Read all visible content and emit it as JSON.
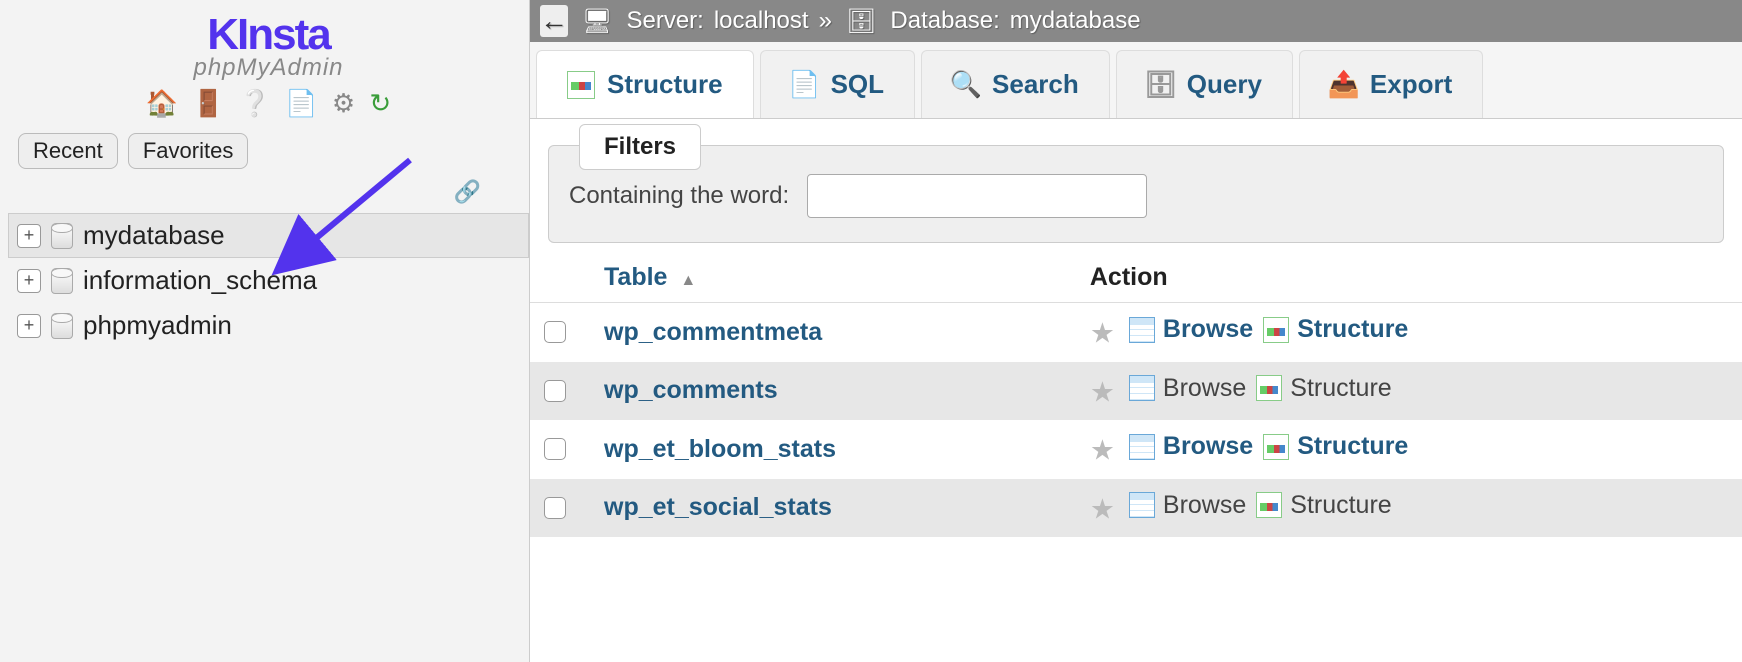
{
  "logo": {
    "brand": "KInsta",
    "sub": "phpMyAdmin"
  },
  "sidebar_tabs": {
    "recent": "Recent",
    "favorites": "Favorites"
  },
  "databases": [
    {
      "name": "mydatabase",
      "selected": true
    },
    {
      "name": "information_schema",
      "selected": false
    },
    {
      "name": "phpmyadmin",
      "selected": false
    }
  ],
  "breadcrumb": {
    "server_label": "Server:",
    "server_value": "localhost",
    "sep": "»",
    "db_label": "Database:",
    "db_value": "mydatabase"
  },
  "tabs": {
    "structure": "Structure",
    "sql": "SQL",
    "search": "Search",
    "query": "Query",
    "export": "Export"
  },
  "filters": {
    "title": "Filters",
    "label": "Containing the word:",
    "value": ""
  },
  "columns": {
    "table": "Table",
    "action": "Action"
  },
  "row_actions": {
    "browse": "Browse",
    "structure": "Structure"
  },
  "tables": [
    "wp_commentmeta",
    "wp_comments",
    "wp_et_bloom_stats",
    "wp_et_social_stats"
  ]
}
